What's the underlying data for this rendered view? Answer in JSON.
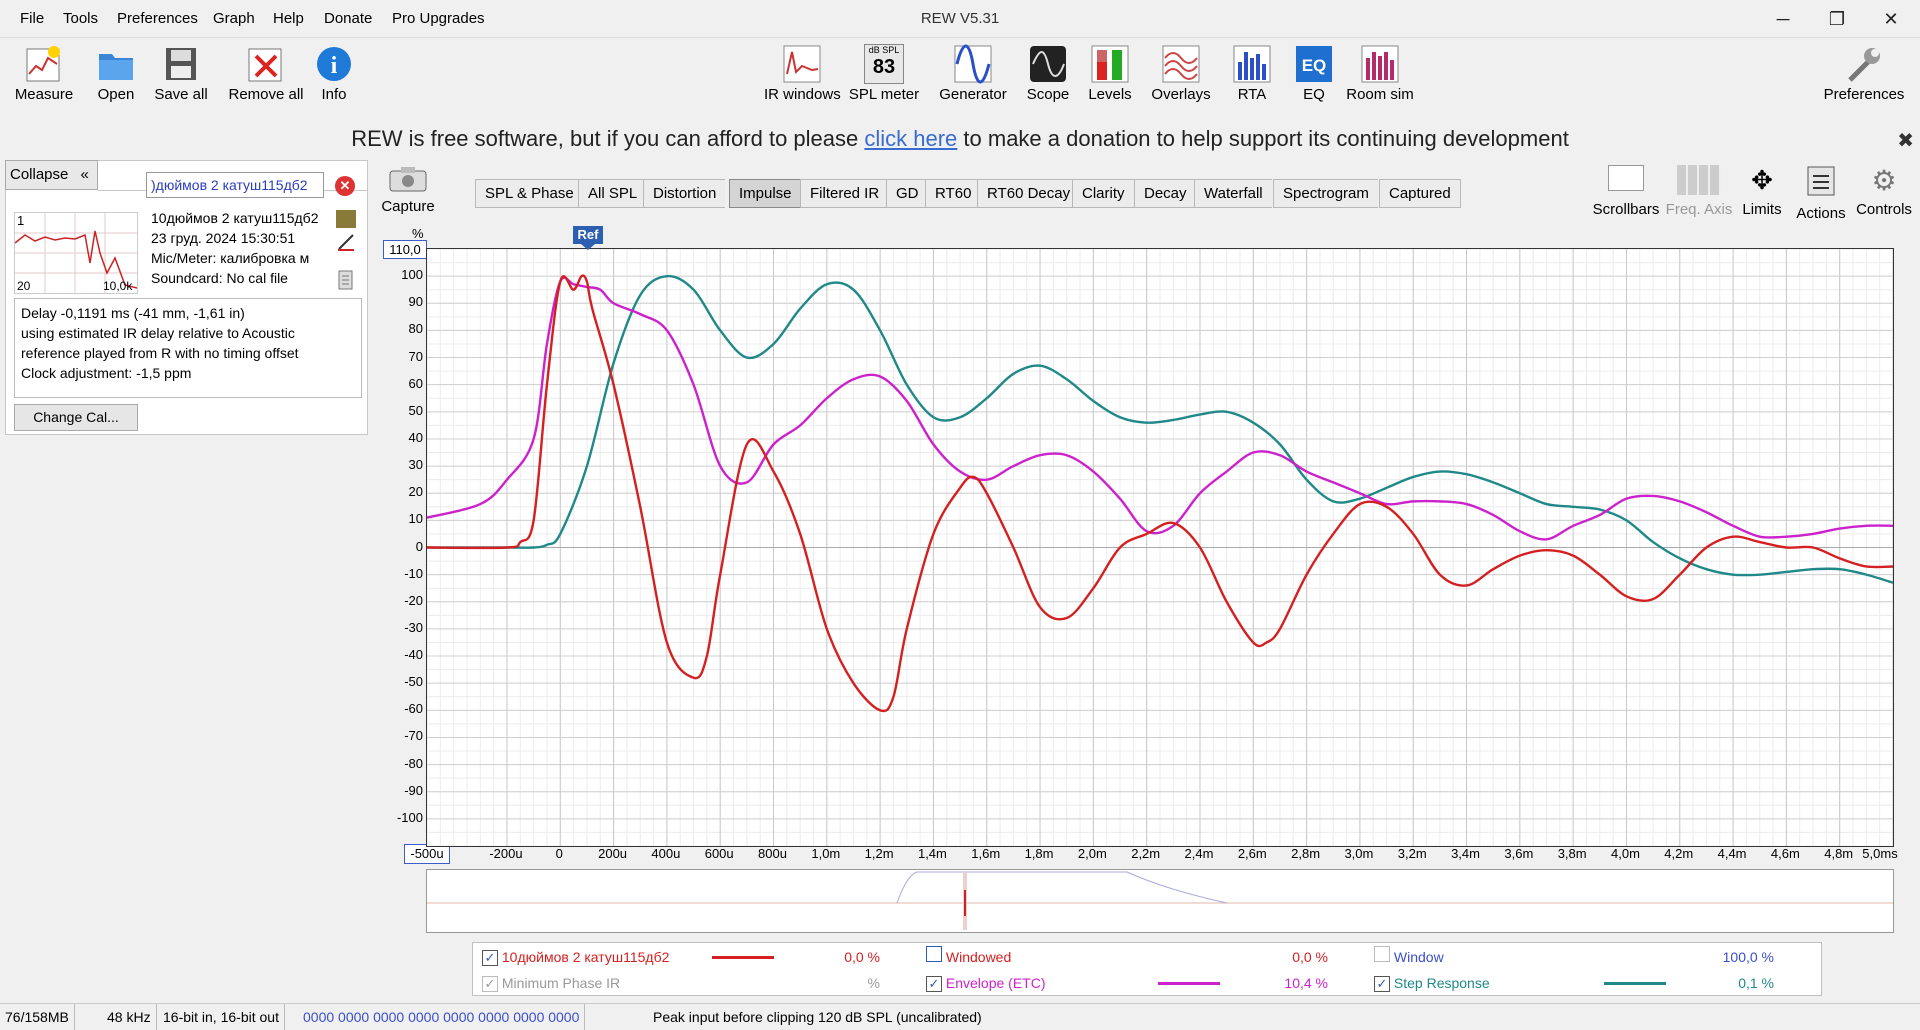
{
  "app": {
    "title": "REW V5.31",
    "menu": [
      "File",
      "Tools",
      "Preferences",
      "Graph",
      "Help",
      "Donate",
      "Pro Upgrades"
    ]
  },
  "toolbar": {
    "left": [
      "Measure",
      "Open",
      "Save all",
      "Remove all",
      "Info"
    ],
    "center": [
      "IR windows",
      "SPL meter",
      "Generator",
      "Scope",
      "Levels",
      "Overlays",
      "RTA",
      "EQ",
      "Room sim"
    ],
    "spl_icon_text": "dB SPL",
    "spl_icon_value": "83",
    "right": "Preferences"
  },
  "banner": {
    "before": "REW is free software, but if you can afford to please ",
    "link": "click here",
    "after": " to make a donation to help support its continuing development"
  },
  "panel": {
    "collapse": "Collapse",
    "measurement_name": "10дюймов 2 катуш115дб2",
    "name_field": ")дюймов 2 катуш115дб2",
    "thumb_num": "1",
    "thumb_min": "20",
    "thumb_max": "10,0k",
    "date": "23 груд. 2024 15:30:51",
    "mic": "Mic/Meter: калибровка м",
    "soundcard": "Soundcard: No cal file",
    "notes": [
      "Delay -0,1191 ms (-41 mm, -1,61 in)",
      "using estimated IR delay relative to Acoustic",
      "reference played from  R with no timing offset",
      "Clock adjustment: -1,5 ppm"
    ],
    "change_cal": "Change Cal..."
  },
  "capture": "Capture",
  "tabs": [
    "SPL & Phase",
    "All SPL",
    "Distortion",
    "Impulse",
    "Filtered IR",
    "GD",
    "RT60",
    "RT60 Decay",
    "Clarity",
    "Decay",
    "Waterfall",
    "Spectrogram",
    "Captured"
  ],
  "active_tab": "Impulse",
  "right_tools": [
    "Scrollbars",
    "Freq. Axis",
    "Limits",
    "Actions",
    "Controls"
  ],
  "graph": {
    "y_unit": "%",
    "y_max": "110,0",
    "y_ticks": [
      "100",
      "90",
      "80",
      "70",
      "60",
      "50",
      "40",
      "30",
      "20",
      "10",
      "0",
      "-10",
      "-20",
      "-30",
      "-40",
      "-50",
      "-60",
      "-70",
      "-80",
      "-90",
      "-100"
    ],
    "x_min": "-500u",
    "x_ticks": [
      "-200u",
      "0",
      "200u",
      "400u",
      "600u",
      "800u",
      "1,0m",
      "1,2m",
      "1,4m",
      "1,6m",
      "1,8m",
      "2,0m",
      "2,2m",
      "2,4m",
      "2,6m",
      "2,8m",
      "3,0m",
      "3,2m",
      "3,4m",
      "3,6m",
      "3,8m",
      "4,0m",
      "4,2m",
      "4,4m",
      "4,6m",
      "4,8m",
      "5,0ms"
    ],
    "ref_marker": "Ref"
  },
  "chart_data": {
    "type": "line",
    "xlabel": "",
    "ylabel": "%",
    "xlim": [
      -0.5,
      5.0
    ],
    "ylim": [
      -110,
      110
    ],
    "series": [
      {
        "name": "10дюймов 2 катуш115дб2",
        "color": "#d42020",
        "x": [
          -0.5,
          -0.2,
          -0.15,
          -0.1,
          -0.05,
          0,
          0.05,
          0.08,
          0.1,
          0.12,
          0.2,
          0.3,
          0.4,
          0.5,
          0.55,
          0.6,
          0.7,
          0.8,
          0.9,
          1.0,
          1.1,
          1.2,
          1.25,
          1.3,
          1.4,
          1.5,
          1.55,
          1.6,
          1.7,
          1.8,
          1.9,
          2.0,
          2.1,
          2.2,
          2.3,
          2.4,
          2.5,
          2.6,
          2.65,
          2.7,
          2.8,
          2.9,
          3.0,
          3.1,
          3.2,
          3.3,
          3.4,
          3.5,
          3.6,
          3.7,
          3.8,
          3.9,
          4.0,
          4.1,
          4.2,
          4.3,
          4.4,
          4.5,
          4.6,
          4.7,
          4.8,
          4.9,
          5.0
        ],
        "y": [
          0,
          0,
          2,
          10,
          60,
          98,
          95,
          100,
          98,
          88,
          60,
          15,
          -35,
          -48,
          -40,
          -10,
          38,
          28,
          5,
          -30,
          -50,
          -60,
          -55,
          -30,
          5,
          22,
          26,
          20,
          0,
          -22,
          -26,
          -15,
          0,
          5,
          9,
          0,
          -20,
          -35,
          -35,
          -30,
          -10,
          5,
          16,
          15,
          5,
          -10,
          -14,
          -8,
          -3,
          -1,
          -3,
          -10,
          -18,
          -19,
          -10,
          0,
          4,
          2,
          0,
          0,
          -4,
          -7,
          -7
        ]
      },
      {
        "name": "Envelope (ETC)",
        "color": "#cc22cc",
        "x": [
          -0.5,
          -0.3,
          -0.2,
          -0.1,
          -0.05,
          0,
          0.05,
          0.1,
          0.15,
          0.2,
          0.3,
          0.4,
          0.5,
          0.6,
          0.7,
          0.8,
          0.9,
          1.0,
          1.1,
          1.2,
          1.3,
          1.4,
          1.5,
          1.6,
          1.7,
          1.8,
          1.9,
          2.0,
          2.1,
          2.2,
          2.3,
          2.4,
          2.5,
          2.6,
          2.7,
          2.8,
          2.9,
          3.0,
          3.1,
          3.2,
          3.3,
          3.4,
          3.5,
          3.6,
          3.7,
          3.8,
          3.9,
          4.0,
          4.1,
          4.2,
          4.3,
          4.4,
          4.5,
          4.6,
          4.7,
          4.8,
          4.9,
          5.0
        ],
        "y": [
          11,
          16,
          25,
          40,
          75,
          98,
          97,
          96,
          95,
          90,
          86,
          80,
          60,
          30,
          24,
          38,
          45,
          55,
          62,
          63,
          54,
          38,
          28,
          25,
          30,
          34,
          34,
          28,
          18,
          6,
          8,
          20,
          28,
          35,
          34,
          28,
          24,
          20,
          16,
          17,
          17,
          16,
          12,
          6,
          3,
          8,
          12,
          18,
          19,
          17,
          13,
          8,
          4,
          4,
          5,
          7,
          8,
          8
        ]
      },
      {
        "name": "Step Response",
        "color": "#208888",
        "x": [
          -0.5,
          -0.2,
          -0.1,
          -0.05,
          0,
          0.1,
          0.2,
          0.3,
          0.4,
          0.5,
          0.6,
          0.7,
          0.8,
          0.9,
          1.0,
          1.1,
          1.2,
          1.3,
          1.4,
          1.5,
          1.6,
          1.7,
          1.8,
          1.9,
          2.0,
          2.1,
          2.2,
          2.3,
          2.4,
          2.5,
          2.6,
          2.7,
          2.8,
          2.9,
          3.0,
          3.1,
          3.2,
          3.3,
          3.4,
          3.5,
          3.6,
          3.7,
          3.8,
          3.9,
          4.0,
          4.1,
          4.2,
          4.3,
          4.4,
          4.5,
          4.6,
          4.7,
          4.8,
          4.9,
          5.0
        ],
        "y": [
          0,
          0,
          0,
          1,
          5,
          30,
          68,
          93,
          100,
          95,
          80,
          70,
          75,
          88,
          97,
          95,
          80,
          60,
          48,
          48,
          55,
          64,
          67,
          62,
          54,
          48,
          46,
          47,
          49,
          50,
          46,
          38,
          25,
          17,
          18,
          22,
          26,
          28,
          27,
          24,
          20,
          16,
          15,
          14,
          10,
          2,
          -4,
          -8,
          -10,
          -10,
          -9,
          -8,
          -8,
          -10,
          -13
        ]
      }
    ]
  },
  "legend": {
    "row1": [
      {
        "label": "10дюймов 2 катуш115дб2",
        "checked": true,
        "value": "0,0 %",
        "color": "#d42020"
      },
      {
        "label": "Windowed",
        "checked": false,
        "value": "0,0 %",
        "color": "#d42020"
      },
      {
        "label": "Window",
        "checked": false,
        "value": "100,0 %",
        "color": "#3a4fcc"
      }
    ],
    "row2": [
      {
        "label": "Minimum Phase IR",
        "checked": true,
        "value": "%",
        "color": "#999999"
      },
      {
        "label": "Envelope (ETC)",
        "checked": true,
        "value": "10,4 %",
        "color": "#cc22cc"
      },
      {
        "label": "Step Response",
        "checked": true,
        "value": "0,1 %",
        "color": "#208888"
      }
    ]
  },
  "status": {
    "memory": "76/158MB",
    "rate": "48 kHz",
    "bits": "16-bit in, 16-bit out",
    "hex": "0000 0000  0000 0000  0000 0000  0000 0000",
    "peak": "Peak input before clipping 120 dB SPL (uncalibrated)"
  }
}
